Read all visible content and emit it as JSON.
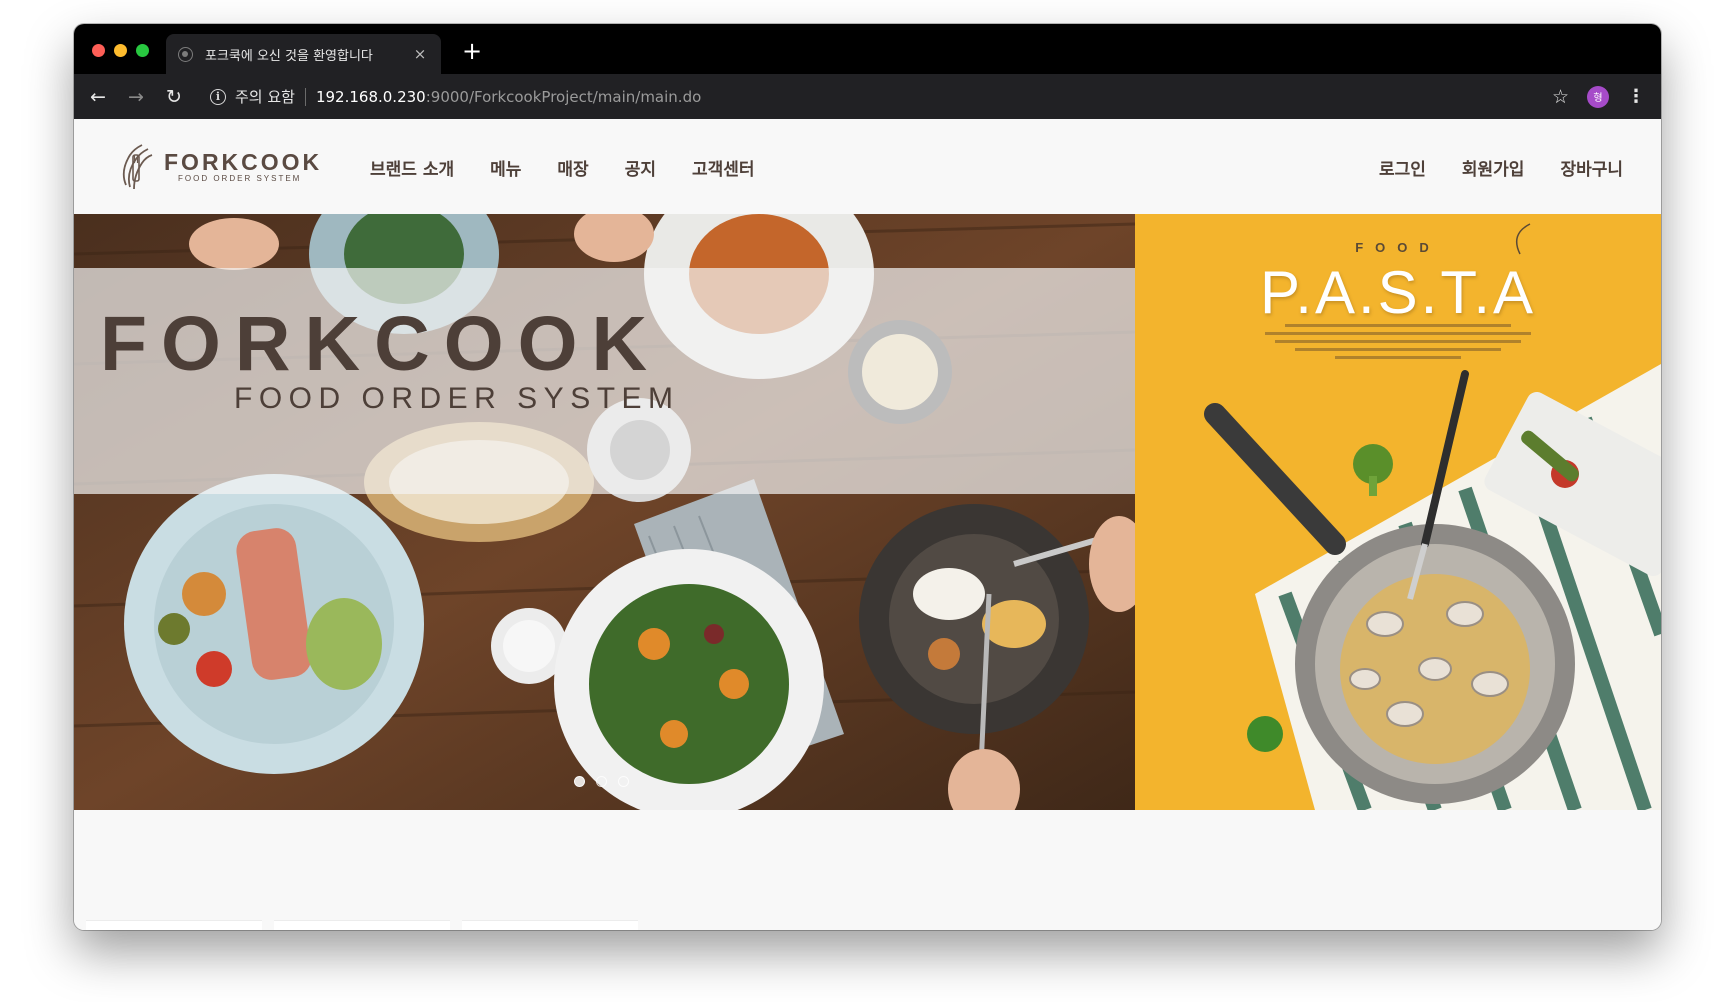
{
  "browser": {
    "tab_title": "포크쿡에 오신 것을 환영합니다",
    "tab_close": "×",
    "new_tab": "+",
    "security_label": "주의 요함",
    "url_host": "192.168.0.230",
    "url_path": ":9000/ForkcookProject/main/main.do",
    "profile_initial": "형"
  },
  "logo": {
    "name": "FORKCOOK",
    "subtitle": "FOOD ORDER SYSTEM"
  },
  "nav": {
    "brand": "브랜드 소개",
    "menu": "메뉴",
    "store": "매장",
    "notice": "공지",
    "support": "고객센터"
  },
  "user_nav": {
    "login": "로그인",
    "signup": "회원가입",
    "cart": "장바구니"
  },
  "hero": {
    "title": "FORKCOOK",
    "subtitle": "FOOD ORDER SYSTEM",
    "slides_count": 3,
    "active_slide": 1
  },
  "promo": {
    "food_label": "FOOD",
    "title": "P.A.S.T.A"
  },
  "colors": {
    "chrome_dark": "#212124",
    "brand_brown": "#4d3f38",
    "promo_yellow": "#f3b42d"
  }
}
